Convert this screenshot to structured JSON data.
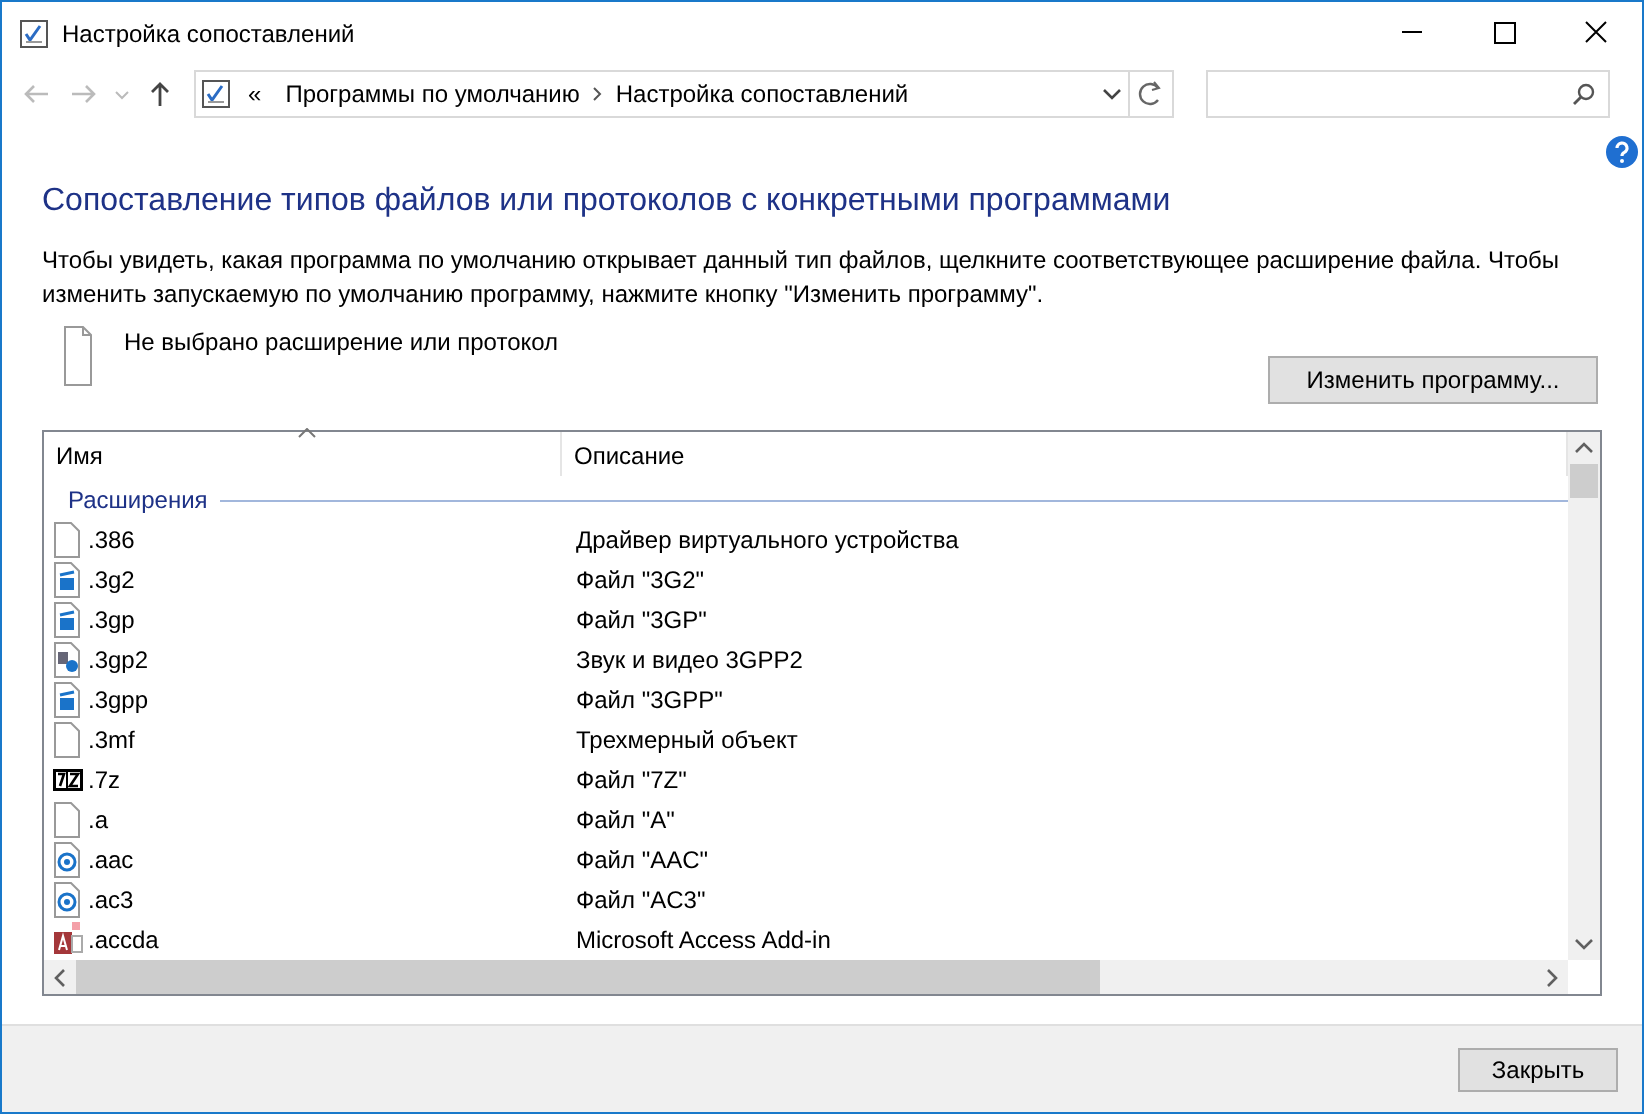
{
  "window": {
    "title": "Настройка сопоставлений"
  },
  "address_bar": {
    "overflow": "«",
    "crumbs": [
      "Программы по умолчанию",
      "Настройка сопоставлений"
    ]
  },
  "heading": "Сопоставление типов файлов или протоколов с конкретными программами",
  "description": "Чтобы увидеть, какая программа по умолчанию открывает данный тип файлов, щелкните соответствующее расширение файла. Чтобы изменить запускаемую по умолчанию программу, нажмите кнопку \"Изменить программу\".",
  "selection": {
    "label": "Не выбрано расширение или протокол"
  },
  "change_button": "Изменить программу...",
  "table": {
    "columns": [
      {
        "label": "Имя",
        "sorted": true
      },
      {
        "label": "Описание",
        "sorted": false
      }
    ],
    "group": "Расширения",
    "rows": [
      {
        "name": ".386",
        "description": "Драйвер виртуального устройства",
        "kind": "blank"
      },
      {
        "name": ".3g2",
        "description": "Файл \"3G2\"",
        "kind": "video"
      },
      {
        "name": ".3gp",
        "description": "Файл \"3GP\"",
        "kind": "video"
      },
      {
        "name": ".3gp2",
        "description": "Звук и видео 3GPP2",
        "kind": "media"
      },
      {
        "name": ".3gpp",
        "description": "Файл \"3GPP\"",
        "kind": "video"
      },
      {
        "name": ".3mf",
        "description": "Трехмерный объект",
        "kind": "blank"
      },
      {
        "name": ".7z",
        "description": "Файл \"7Z\"",
        "kind": "archive"
      },
      {
        "name": ".a",
        "description": "Файл \"A\"",
        "kind": "blank"
      },
      {
        "name": ".aac",
        "description": "Файл \"AAC\"",
        "kind": "audio"
      },
      {
        "name": ".ac3",
        "description": "Файл \"AC3\"",
        "kind": "audio"
      },
      {
        "name": ".accda",
        "description": "Microsoft Access Add-in",
        "kind": "access"
      }
    ]
  },
  "close_button": "Закрыть"
}
